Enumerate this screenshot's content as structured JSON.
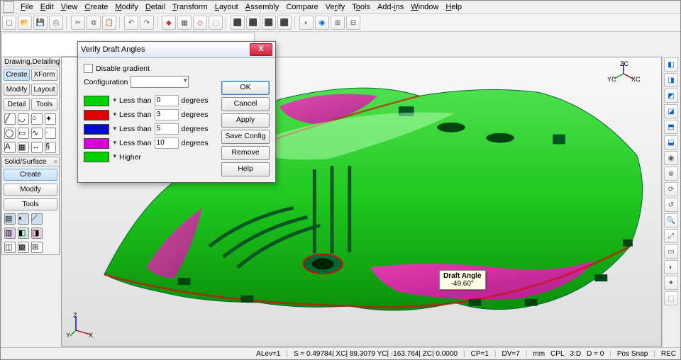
{
  "menu": {
    "items": [
      "File",
      "Edit",
      "View",
      "Create",
      "Modify",
      "Detail",
      "Transform",
      "Layout",
      "Assembly",
      "Compare",
      "Verify",
      "Tools",
      "Add-ins",
      "Window",
      "Help"
    ]
  },
  "panels": {
    "drawing": {
      "title": "Drawing,Detailing",
      "tabs": [
        "Create",
        "XForm",
        "Modify",
        "Layout",
        "Detail",
        "Tools"
      ]
    },
    "solid": {
      "title": "Solid/Surface",
      "tabs": [
        "Create",
        "Modify",
        "Tools"
      ]
    }
  },
  "viewport": {
    "triad_tr": {
      "x": "XC",
      "y": "YC",
      "z": "ZC"
    },
    "triad_bl": {
      "x": "X",
      "y": "Y",
      "z": "Z"
    },
    "draft_label": {
      "title": "Draft Angle",
      "value": "-49.60°"
    }
  },
  "dialog": {
    "title": "Verify Draft Angles",
    "disable_gradient": "Disable gradient",
    "configuration": "Configuration",
    "less_than": "Less than",
    "higher": "Higher",
    "degrees": "degrees",
    "rows": [
      {
        "color": "#00d000",
        "val": "0"
      },
      {
        "color": "#e00000",
        "val": "3"
      },
      {
        "color": "#0010c0",
        "val": "5"
      },
      {
        "color": "#d800d8",
        "val": "10"
      }
    ],
    "higher_color": "#00d000",
    "buttons": {
      "ok": "OK",
      "cancel": "Cancel",
      "apply": "Apply",
      "save": "Save Config",
      "remove": "Remove",
      "help": "Help"
    }
  },
  "status": {
    "alev": "ALev=1",
    "coords": "S = 0.49784| XC| 89.3079   YC| -163.764| ZC| 0.0000",
    "cp": "CP=1",
    "dv": "DV=7",
    "units": "mm",
    "cpl": "CPL",
    "d3": "3:D",
    "d0": "D = 0",
    "snap": "Pos Snap",
    "rec": "REC"
  }
}
